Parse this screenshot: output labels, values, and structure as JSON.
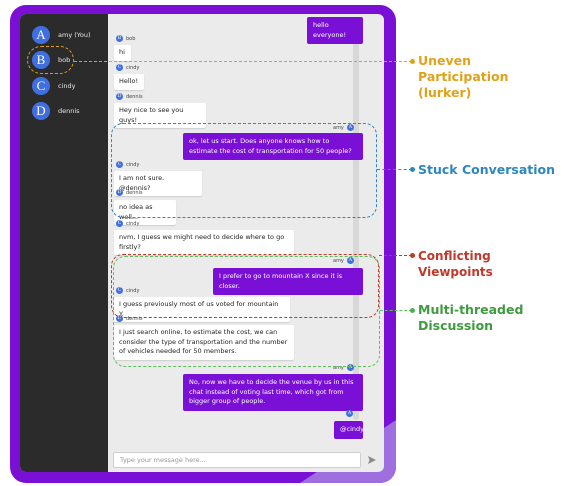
{
  "colors": {
    "frame": "#7a0fd6",
    "outgoing_bubble": "#7a0fd6",
    "avatar": "#3f6fe0",
    "sidebar": "#2b2b2b",
    "uneven": "#e0a21a",
    "stuck": "#2e86c1",
    "conflict": "#c0392b",
    "multithread": "#4caf50"
  },
  "sidebar": {
    "contacts": [
      {
        "initial": "A",
        "name": "amy (You)"
      },
      {
        "initial": "B",
        "name": "bob"
      },
      {
        "initial": "C",
        "name": "cindy"
      },
      {
        "initial": "D",
        "name": "dennis"
      }
    ]
  },
  "messages": [
    {
      "dir": "out",
      "text": "hello everyone!"
    },
    {
      "dir": "in",
      "sender": "bob",
      "initial": "B",
      "text": "hi"
    },
    {
      "dir": "in",
      "sender": "cindy",
      "initial": "C",
      "text": "Hello!"
    },
    {
      "dir": "in",
      "sender": "dennis",
      "initial": "D",
      "text": "Hey nice to see you guys!"
    },
    {
      "dir": "out",
      "sender": "amy",
      "initial": "A",
      "text": "ok, let us start. Does anyone knows how to estimate the cost of transportation for 50 people?"
    },
    {
      "dir": "in",
      "sender": "cindy",
      "initial": "C",
      "text": "I am not sure. @dennis?"
    },
    {
      "dir": "in",
      "sender": "dennis",
      "initial": "D",
      "text": "no idea as well..."
    },
    {
      "dir": "in",
      "sender": "cindy",
      "initial": "C",
      "text": "nvm, I guess we might need to decide where to go firstly?"
    },
    {
      "dir": "out",
      "sender": "amy",
      "initial": "A",
      "text": "I prefer to go to mountain X since it is closer."
    },
    {
      "dir": "in",
      "sender": "cindy",
      "initial": "C",
      "text": "I guess previously most of us voted for mountain Y."
    },
    {
      "dir": "in",
      "sender": "dennis",
      "initial": "D",
      "text": "I just search online, to estimate the cost, we can consider the type of transportation and the number of vehicles needed for 50 members."
    },
    {
      "dir": "out",
      "sender": "amy",
      "initial": "A",
      "text": "No, now we have to decide the venue by us in this chat instead of voting last time, which got from bigger group of people."
    },
    {
      "dir": "out",
      "sender": "amy",
      "initial": "A",
      "text": "@cindy"
    }
  ],
  "input": {
    "placeholder": "Type your message here..."
  },
  "annotations": {
    "uneven": "Uneven Participation (lurker)",
    "stuck": "Stuck Conversation",
    "conflict": "Conflicting Viewpoints",
    "multithread": "Multi-threaded Discussion"
  }
}
